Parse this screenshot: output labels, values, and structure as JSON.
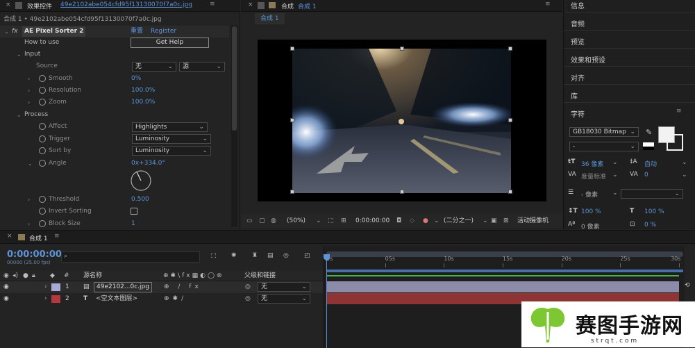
{
  "effect_controls": {
    "close_glyph": "×",
    "panel_title": "效果控件",
    "file_name": "49e2102abe054cfd95f13130070f7a0c.jpg",
    "breadcrumb": "合成 1 • 49e2102abe054cfd95f13130070f7a0c.jpg",
    "effect_name": "AE Pixel Sorter 2",
    "fx_label": "fx",
    "reset_link": "重置",
    "register_link": "Register",
    "how_to_use": "How to use",
    "get_help": "Get Help",
    "input_group": "Input",
    "source_label": "Source",
    "source_value_1": "无",
    "source_value_2": "源",
    "smooth_label": "Smooth",
    "smooth_value": "0%",
    "resolution_label": "Resolution",
    "resolution_value": "100.0%",
    "zoom_label": "Zoom",
    "zoom_value": "100.0%",
    "process_group": "Process",
    "affect_label": "Affect",
    "affect_value": "Highlights",
    "trigger_label": "Trigger",
    "trigger_value": "Luminosity",
    "sortby_label": "Sort by",
    "sortby_value": "Luminosity",
    "angle_label": "Angle",
    "angle_value": "0x+334.0°",
    "threshold_label": "Threshold",
    "threshold_value": "0.500",
    "invert_label": "Invert Sorting",
    "blocksize_label": "Block Size",
    "blocksize_value": "1"
  },
  "composition": {
    "panel_title": "合成",
    "comp_name": "合成 1",
    "tab_label": "合成 1",
    "zoom": "(50%)",
    "timecode": "0:00:00:00",
    "resolution": "(二分之一)",
    "camera": "活动摄像机"
  },
  "right_panel": {
    "items": [
      "信息",
      "音频",
      "预览",
      "效果和预设",
      "对齐",
      "库"
    ],
    "character_title": "字符",
    "font_name": "GB18030 Bitmap",
    "font_style": "-",
    "font_size": "36 像素",
    "leading": "自动",
    "kerning_label": "度量标准",
    "tracking": "0",
    "stroke_width": "- 像素",
    "vscale": "100 %",
    "hscale": "100 %",
    "baseline": "0 像素",
    "tsume": "0 %"
  },
  "timeline": {
    "close_glyph": "×",
    "comp_tab": "合成 1",
    "timecode": "0:00:00:00",
    "frame_info": "00000 (25.00 fps)",
    "search_placeholder": "",
    "col_hash": "#",
    "col_source": "源名称",
    "col_parent": "父级和链接",
    "ruler": [
      "0s",
      "05s",
      "10s",
      "15s",
      "20s",
      "25s",
      "30s"
    ],
    "layers": [
      {
        "num": "1",
        "name": "49e2102...0c.jpg",
        "parent": "无",
        "color": "#a9a9d8"
      },
      {
        "num": "2",
        "name": "<空文本图层>",
        "parent": "无",
        "color": "#b23a3a"
      }
    ]
  },
  "watermark": {
    "title": "赛图手游网",
    "url": "s t r q t . c o m"
  },
  "colors": {
    "accent_blue": "#5d93d8",
    "layer1_track": "#8c8caa",
    "layer2_track": "#8f3434",
    "work_area": "#4a6fa8",
    "watermark_green": "#7dc832"
  }
}
